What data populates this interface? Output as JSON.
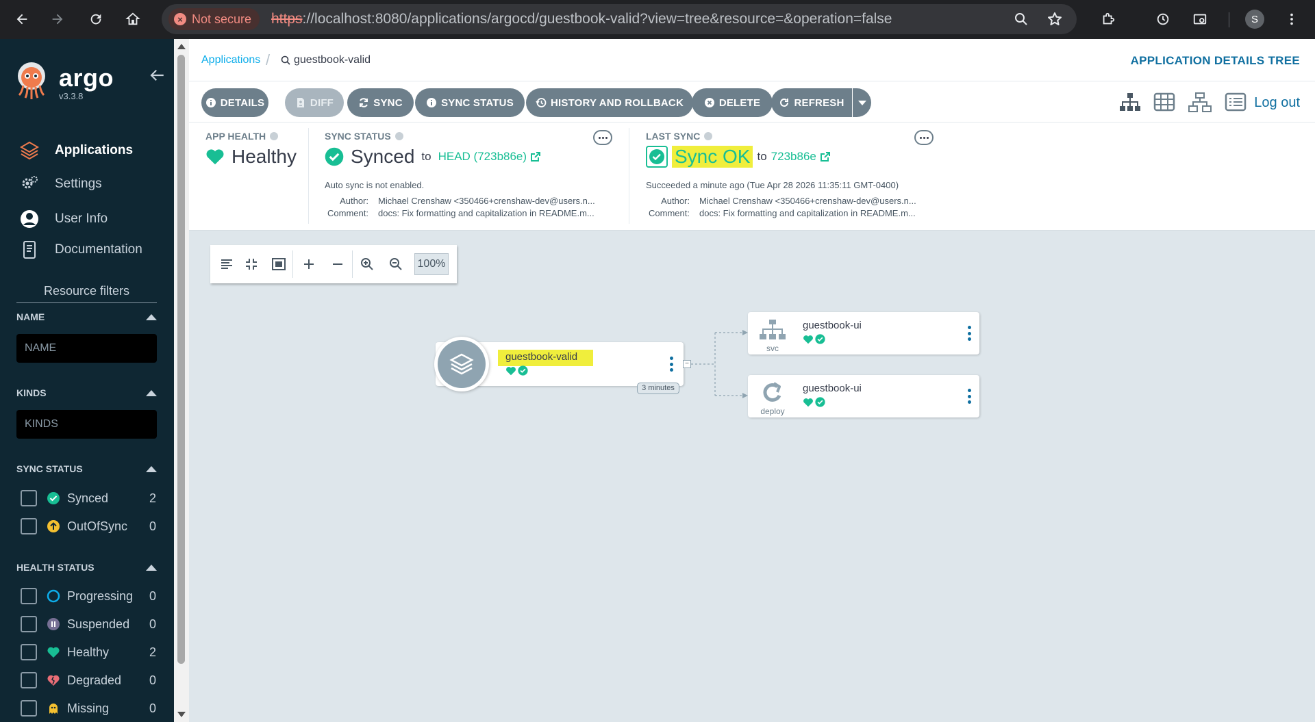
{
  "browser": {
    "not_secure": "Not secure",
    "url_scheme": "https",
    "url_rest": "://localhost:8080/applications/argocd/guestbook-valid?view=tree&resource=&operation=false",
    "profile_initial": "S"
  },
  "sidebar": {
    "brand": "argo",
    "version": "v3.3.8",
    "nav": [
      {
        "label": "Applications",
        "icon": "layers-icon"
      },
      {
        "label": "Settings",
        "icon": "gears-icon"
      },
      {
        "label": "User Info",
        "icon": "user-icon"
      },
      {
        "label": "Documentation",
        "icon": "docs-icon"
      }
    ],
    "filters_title": "Resource filters",
    "name_label": "NAME",
    "name_placeholder": "NAME",
    "kinds_label": "KINDS",
    "kinds_placeholder": "KINDS",
    "sync_status_label": "SYNC STATUS",
    "sync_status": [
      {
        "label": "Synced",
        "count": "2",
        "icon": "check-circle-icon",
        "color": "#18be94"
      },
      {
        "label": "OutOfSync",
        "count": "0",
        "icon": "arrow-up-circle-icon",
        "color": "#f4c030"
      }
    ],
    "health_status_label": "HEALTH STATUS",
    "health_status": [
      {
        "label": "Progressing",
        "count": "0",
        "icon": "progress-circle-icon",
        "color": "#0dadea"
      },
      {
        "label": "Suspended",
        "count": "0",
        "icon": "pause-icon",
        "color": "#766f94"
      },
      {
        "label": "Healthy",
        "count": "2",
        "icon": "heart-icon",
        "color": "#18be94"
      },
      {
        "label": "Degraded",
        "count": "0",
        "icon": "broken-heart-icon",
        "color": "#e96d76"
      },
      {
        "label": "Missing",
        "count": "0",
        "icon": "ghost-icon",
        "color": "#f4c030"
      }
    ]
  },
  "header": {
    "breadcrumb_root": "Applications",
    "breadcrumb_current": "guestbook-valid",
    "title": "APPLICATION DETAILS TREE"
  },
  "toolbar": {
    "details": "DETAILS",
    "diff": "DIFF",
    "sync": "SYNC",
    "sync_status": "SYNC STATUS",
    "history": "HISTORY AND ROLLBACK",
    "delete": "DELETE",
    "refresh": "REFRESH",
    "logout": "Log out"
  },
  "status": {
    "app_health_label": "APP HEALTH",
    "app_health": "Healthy",
    "sync_status_label": "SYNC STATUS",
    "sync_status": "Synced",
    "sync_to": "to",
    "sync_revision": "HEAD (723b86e)",
    "auto_sync": "Auto sync is not enabled.",
    "author_label": "Author:",
    "author": "Michael Crenshaw <350466+crenshaw-dev@users.n...",
    "comment_label": "Comment:",
    "comment": "docs: Fix formatting and capitalization in README.m...",
    "last_sync_label": "LAST SYNC",
    "last_sync": "Sync OK",
    "last_sync_to": "to",
    "last_sync_revision": "723b86e",
    "last_sync_time": "Succeeded a minute ago (Tue Apr 28 2026 11:35:11 GMT-0400)",
    "ls_author_label": "Author:",
    "ls_author": "Michael Crenshaw <350466+crenshaw-dev@users.n...",
    "ls_comment_label": "Comment:",
    "ls_comment": "docs: Fix formatting and capitalization in README.m..."
  },
  "graph": {
    "zoom": "100%",
    "app_node": {
      "name": "guestbook-valid",
      "age": "3 minutes"
    },
    "resources": [
      {
        "name": "guestbook-ui",
        "kind": "svc"
      },
      {
        "name": "guestbook-ui",
        "kind": "deploy"
      }
    ]
  },
  "colors": {
    "sidebar_bg": "#0f2733",
    "accent": "#0dadea",
    "healthy": "#18be94",
    "highlight": "#f0ee3c",
    "button": "#6d7f8b"
  }
}
